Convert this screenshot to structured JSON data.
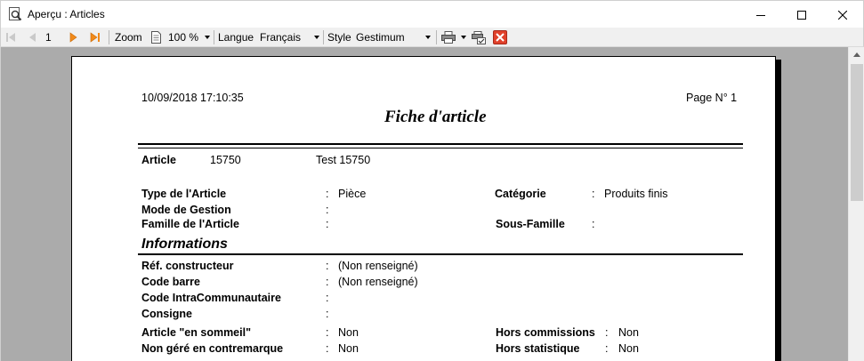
{
  "window": {
    "title": "Aperçu : Articles"
  },
  "toolbar": {
    "page": "1",
    "zoom_label": "Zoom",
    "zoom_value": "100 %",
    "langue_label": "Langue",
    "langue_value": "Français",
    "style_label": "Style",
    "style_value": "Gestimum"
  },
  "report": {
    "datetime": "10/09/2018 17:10:35",
    "page_label": "Page N° 1",
    "title": "Fiche d'article",
    "article_label": "Article",
    "article_code": "15750",
    "article_name": "Test 15750",
    "colon": ":",
    "fields_left": [
      {
        "label": "Type de l'Article",
        "value": "Pièce"
      },
      {
        "label": "Mode de Gestion",
        "value": ""
      },
      {
        "label": "Famille de l'Article",
        "value": ""
      }
    ],
    "fields_right": [
      {
        "label": "Catégorie",
        "value": "Produits finis"
      },
      {
        "label": "Sous-Famille",
        "value": ""
      }
    ],
    "section_title": "Informations",
    "info_left": [
      {
        "label": "Réf. constructeur",
        "value": "(Non renseigné)"
      },
      {
        "label": "Code barre",
        "value": "(Non renseigné)"
      },
      {
        "label": "Code IntraCommunautaire",
        "value": ""
      },
      {
        "label": "Consigne",
        "value": ""
      },
      {
        "label": "Article \"en sommeil\"",
        "value": "Non"
      },
      {
        "label": "Non géré en contremarque",
        "value": "Non"
      }
    ],
    "info_right": [
      {
        "label": "Hors commissions",
        "value": "Non"
      },
      {
        "label": "Hors statistique",
        "value": "Non"
      }
    ]
  }
}
